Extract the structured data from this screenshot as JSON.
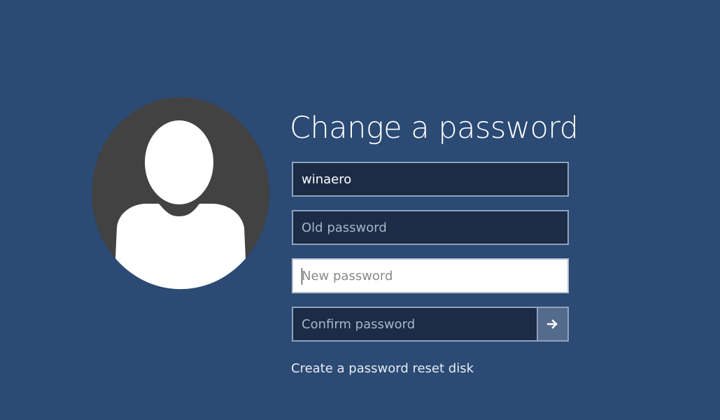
{
  "title": "Change a password",
  "fields": {
    "username": {
      "value": "winaero"
    },
    "old_password": {
      "placeholder": "Old password"
    },
    "new_password": {
      "placeholder": "New password"
    },
    "confirm_password": {
      "placeholder": "Confirm password"
    }
  },
  "submit_icon": "arrow-right-icon",
  "reset_link": "Create a password reset disk",
  "colors": {
    "background": "#2b4a74",
    "avatar_bg": "#424242",
    "field_bg": "#1c2b46",
    "field_border": "#8fa3bd",
    "submit_bg": "#546b8b"
  }
}
